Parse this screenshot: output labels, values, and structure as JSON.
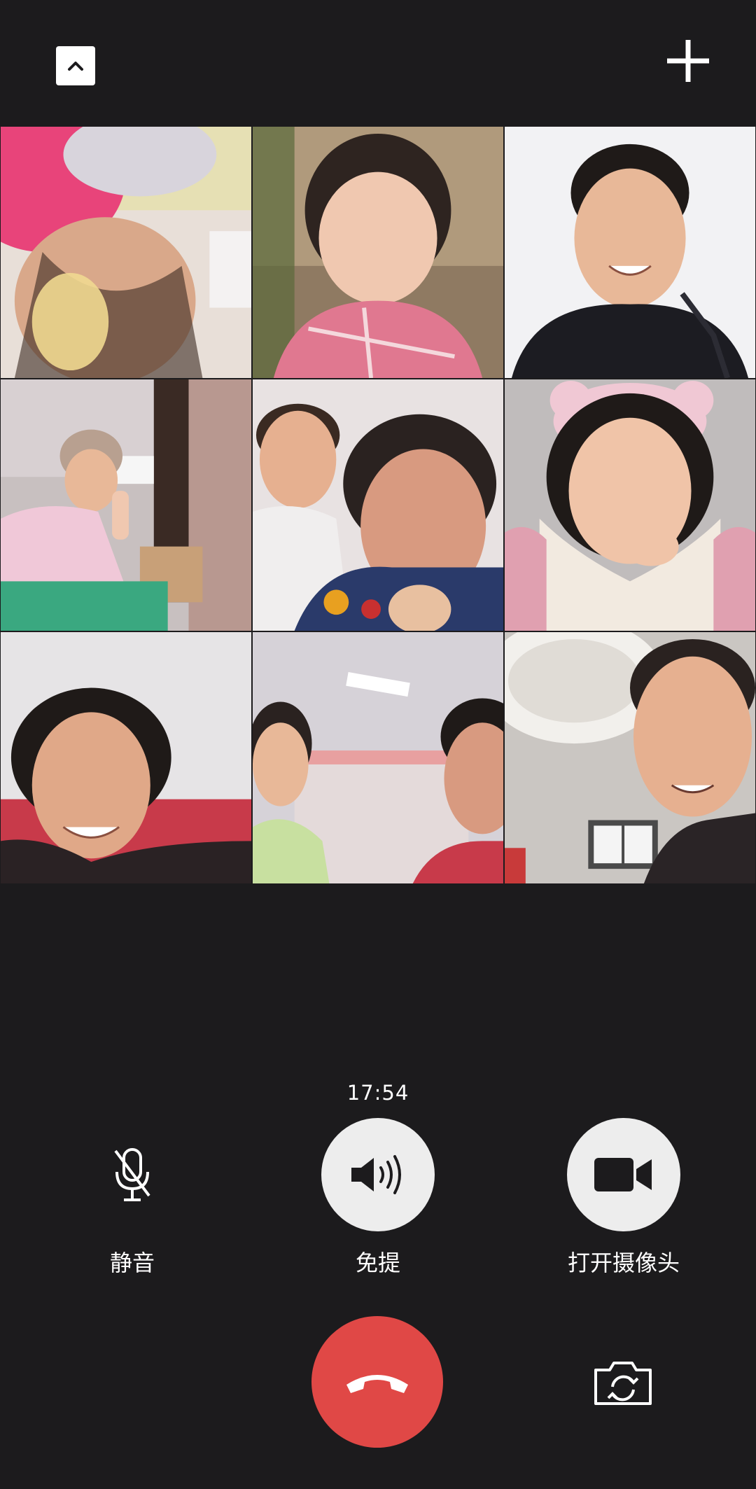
{
  "top_bar": {
    "collapse_icon": "chevron-up-icon",
    "add_icon": "plus-icon"
  },
  "video_grid": {
    "participants": [
      {
        "position": "row1-col1",
        "scene": "child close-up, pink hat"
      },
      {
        "position": "row1-col2",
        "scene": "little girl, pink jacket"
      },
      {
        "position": "row1-col3",
        "scene": "young man smiling, black jacket"
      },
      {
        "position": "row2-col1",
        "scene": "woman in pink coat, peace sign"
      },
      {
        "position": "row2-col2",
        "scene": "two elderly women laughing"
      },
      {
        "position": "row2-col3",
        "scene": "woman with pink headband, fleece scarf"
      },
      {
        "position": "row3-col1",
        "scene": "woman smiling, red blanket"
      },
      {
        "position": "row3-col2",
        "scene": "two people, ceiling light"
      },
      {
        "position": "row3-col3",
        "scene": "boy smiling, round ceiling"
      }
    ]
  },
  "call": {
    "timer": "17:54"
  },
  "controls": {
    "mute": {
      "label": "静音",
      "icon": "microphone-off-icon"
    },
    "speaker": {
      "label": "免提",
      "icon": "speaker-icon"
    },
    "camera": {
      "label": "打开摄像头",
      "icon": "video-camera-icon"
    },
    "hangup": {
      "icon": "hang-up-phone-icon"
    },
    "flip_camera": {
      "icon": "switch-camera-icon"
    }
  },
  "colors": {
    "background": "#1c1b1d",
    "button_light": "#ededed",
    "hangup_red": "#e04846",
    "icon_dark": "#1c1b1d"
  }
}
